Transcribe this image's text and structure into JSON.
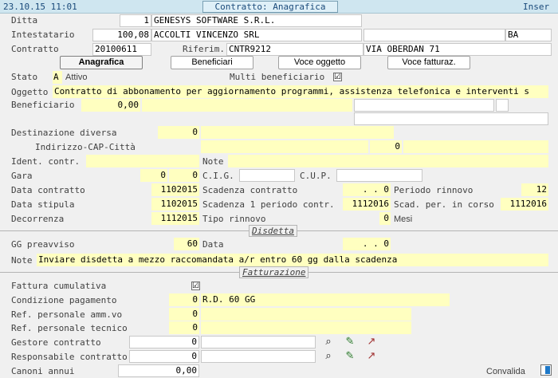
{
  "header": {
    "datetime": "23.10.15 11:01",
    "title": "Contratto: Anagrafica",
    "mode": "Inser"
  },
  "ditta": {
    "label": "Ditta",
    "code": "1",
    "name": "GENESYS SOFTWARE S.R.L."
  },
  "intestatario": {
    "label": "Intestatario",
    "code": "100,08",
    "name": "ACCOLTI VINCENZO SRL",
    "extra": "",
    "prov": "BA"
  },
  "contratto": {
    "label": "Contratto",
    "number": "20100611",
    "riferim_label": "Riferim.",
    "riferim": "CNTR9212",
    "address": "VIA OBERDAN 71"
  },
  "tabs": [
    {
      "label": "Anagrafica"
    },
    {
      "label": "Beneficiari"
    },
    {
      "label": "Voce oggetto"
    },
    {
      "label": "Voce fatturaz."
    }
  ],
  "stato": {
    "label": "Stato",
    "code": "A",
    "text": "Attivo",
    "multi_label": "Multi beneficiario",
    "multi_checked": "☑"
  },
  "oggetto": {
    "label": "Oggetto",
    "value": "Contratto di abbonamento per aggiornamento programmi, assistenza telefonica e interventi s"
  },
  "beneficiario": {
    "label": "Beneficiario",
    "code": "0,00",
    "name": ""
  },
  "destinazione": {
    "label": "Destinazione diversa",
    "code": "0",
    "name": "",
    "indirizzo_label": "Indirizzo-CAP-Città",
    "cap": "0"
  },
  "ident": {
    "label": "Ident. contr.",
    "value": "",
    "note_label": "Note",
    "note": ""
  },
  "gara": {
    "label": "Gara",
    "v1": "0",
    "v2": "0",
    "cig_label": "C.I.G.",
    "cig": "",
    "cup_label": "C.U.P.",
    "cup": ""
  },
  "data_contratto": {
    "label": "Data contratto",
    "value": "1102015",
    "scad_label": "Scadenza contratto",
    "scad": ". . 0",
    "periodo_label": "Periodo rinnovo",
    "periodo": "12"
  },
  "data_stipula": {
    "label": "Data stipula",
    "value": "1102015",
    "scad1_label": "Scadenza 1 periodo contr.",
    "scad1": "1112016",
    "scadper_label": "Scad. per. in corso",
    "scadper": "1112016"
  },
  "decorrenza": {
    "label": "Decorrenza",
    "value": "1112015",
    "tipo_label": "Tipo rinnovo",
    "tipo": "0",
    "tipo_text": "Mesi"
  },
  "disdetta": {
    "section": "Disdetta",
    "gg_label": "GG preavviso",
    "gg": "60",
    "data_label": "Data",
    "data": ". . 0",
    "note_label": "Note",
    "note": "Inviare disdetta a mezzo raccomandata a/r entro 60 gg dalla scadenza"
  },
  "fatturazione": {
    "section": "Fatturazione",
    "cumulativa_label": "Fattura cumulativa",
    "cumulativa_checked": "☑",
    "condizione_label": "Condizione pagamento",
    "condizione_code": "0",
    "condizione_text": "R.D. 60 GG",
    "ref_amm_label": "Ref. personale amm.vo",
    "ref_amm": "0",
    "ref_tec_label": "Ref. personale tecnico",
    "ref_tec": "0",
    "gestore_label": "Gestore contratto",
    "gestore": "0",
    "responsabile_label": "Responsabile contratto",
    "responsabile": "0",
    "canoni_label": "Canoni annui",
    "canoni": "0,00",
    "convalida_label": "Convalida"
  },
  "icons": {
    "search": "binoculars-icon",
    "edit": "edit-icon",
    "detail": "detail-icon"
  },
  "colors": {
    "title_bg": "#cfe6f0",
    "yellow": "#ffffc0",
    "window_bg": "#f0f0f0",
    "accent": "#1e78c8"
  }
}
